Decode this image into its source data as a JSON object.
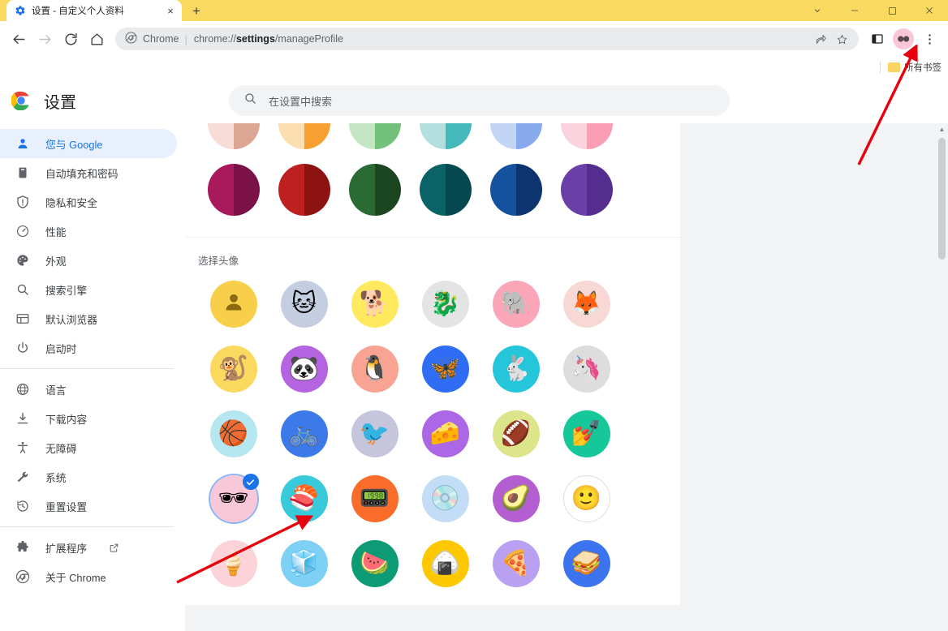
{
  "window": {
    "tab_title": "设置 - 自定义个人资料",
    "tab_close_label": "×",
    "new_tab_label": "+",
    "controls": {
      "collapse": "⌄",
      "minimize": "−",
      "maximize": "□",
      "close": "✕"
    }
  },
  "toolbar": {
    "back_icon": "back-arrow-icon",
    "forward_icon": "forward-arrow-icon",
    "reload_icon": "reload-icon",
    "home_icon": "home-icon",
    "omnibox": {
      "chip_label": "Chrome",
      "separator": "|",
      "url_prefix": "chrome://",
      "url_bold": "settings",
      "url_suffix": "/manageProfile",
      "share_icon": "share-icon",
      "bookmark_icon": "star-icon"
    },
    "side_panel_icon": "side-panel-icon",
    "profile_icon": "profile-avatar-sunglasses-icon",
    "menu_icon": "three-dot-menu-icon"
  },
  "bookmarks_bar": {
    "all_bookmarks_label": "所有书签",
    "folder_icon": "folder-icon"
  },
  "settings": {
    "logo": "chrome-logo-icon",
    "title": "设置",
    "search": {
      "icon": "search-icon",
      "placeholder": "在设置中搜索"
    }
  },
  "sidebar": {
    "items": [
      {
        "label": "您与 Google",
        "icon": "person-icon",
        "active": true
      },
      {
        "label": "自动填充和密码",
        "icon": "clipboard-icon",
        "active": false
      },
      {
        "label": "隐私和安全",
        "icon": "shield-icon",
        "active": false
      },
      {
        "label": "性能",
        "icon": "gauge-icon",
        "active": false
      },
      {
        "label": "外观",
        "icon": "palette-icon",
        "active": false
      },
      {
        "label": "搜索引擎",
        "icon": "search-icon",
        "active": false
      },
      {
        "label": "默认浏览器",
        "icon": "browser-window-icon",
        "active": false
      },
      {
        "label": "启动时",
        "icon": "power-icon",
        "active": false
      }
    ],
    "items2": [
      {
        "label": "语言",
        "icon": "globe-icon"
      },
      {
        "label": "下载内容",
        "icon": "download-icon"
      },
      {
        "label": "无障碍",
        "icon": "accessibility-icon"
      },
      {
        "label": "系统",
        "icon": "wrench-icon"
      },
      {
        "label": "重置设置",
        "icon": "history-restore-icon"
      }
    ],
    "items3": [
      {
        "label": "扩展程序",
        "icon": "puzzle-icon",
        "external": true
      },
      {
        "label": "关于 Chrome",
        "icon": "chrome-logo-icon",
        "external": false
      }
    ]
  },
  "profile_customization": {
    "color_rows": [
      [
        {
          "name": "peach",
          "light": "#f6ddd6",
          "dark": "#dba794"
        },
        {
          "name": "orange",
          "light": "#fcdfb0",
          "dark": "#f5a030"
        },
        {
          "name": "green",
          "light": "#c4e5c1",
          "dark": "#74c17c"
        },
        {
          "name": "teal",
          "light": "#b3e0df",
          "dark": "#45b8bb"
        },
        {
          "name": "blue",
          "light": "#c3d5f5",
          "dark": "#87a9ee"
        },
        {
          "name": "pink",
          "light": "#fbd3de",
          "dark": "#fa9db5"
        }
      ],
      [
        {
          "name": "magenta",
          "light": "#a81a5c",
          "dark": "#7b1247"
        },
        {
          "name": "red",
          "light": "#be1f1f",
          "dark": "#8c1212"
        },
        {
          "name": "dark-green",
          "light": "#2a6b34",
          "dark": "#1b4620"
        },
        {
          "name": "dark-teal",
          "light": "#0a6366",
          "dark": "#06484f"
        },
        {
          "name": "dark-blue",
          "light": "#14519e",
          "dark": "#0e3470"
        },
        {
          "name": "purple",
          "light": "#6b3fa8",
          "dark": "#552d8e"
        }
      ]
    ],
    "avatar_section_label": "选择头像",
    "avatar_rows": [
      [
        {
          "name": "default-person",
          "bg": "#f8cf4a",
          "glyph": "👤",
          "kind": "person",
          "selected": false
        },
        {
          "name": "origami-cat",
          "bg": "#c4cee0",
          "glyph": "🐱",
          "kind": "emoji",
          "selected": false
        },
        {
          "name": "origami-dog",
          "bg": "#ffe95e",
          "glyph": "🐕",
          "kind": "emoji",
          "selected": false
        },
        {
          "name": "origami-dragon",
          "bg": "#e3e4e3",
          "glyph": "🐉",
          "kind": "emoji",
          "selected": false
        },
        {
          "name": "origami-elephant",
          "bg": "#fba5b8",
          "glyph": "🐘",
          "kind": "emoji",
          "selected": false
        },
        {
          "name": "origami-fox",
          "bg": "#f7d8d4",
          "glyph": "🦊",
          "kind": "emoji",
          "selected": false
        }
      ],
      [
        {
          "name": "origami-monkey",
          "bg": "#fbd95f",
          "glyph": "🐒",
          "kind": "emoji",
          "selected": false
        },
        {
          "name": "origami-panda",
          "bg": "#b464e0",
          "glyph": "🐼",
          "kind": "emoji",
          "selected": false
        },
        {
          "name": "origami-penguin",
          "bg": "#f9a492",
          "glyph": "🐧",
          "kind": "emoji",
          "selected": false
        },
        {
          "name": "origami-butterfly",
          "bg": "#2f6ef4",
          "glyph": "🦋",
          "kind": "emoji",
          "selected": false
        },
        {
          "name": "origami-rabbit",
          "bg": "#26c6da",
          "glyph": "🐇",
          "kind": "emoji",
          "selected": false
        },
        {
          "name": "origami-unicorn",
          "bg": "#dddddd",
          "glyph": "🦄",
          "kind": "emoji",
          "selected": false
        }
      ],
      [
        {
          "name": "basketball",
          "bg": "#b4e7ef",
          "glyph": "🏀",
          "kind": "emoji",
          "selected": false
        },
        {
          "name": "bicycle",
          "bg": "#3b7ae8",
          "glyph": "🚲",
          "kind": "emoji",
          "selected": false
        },
        {
          "name": "bird",
          "bg": "#c5c5dc",
          "glyph": "🐦",
          "kind": "emoji",
          "selected": false
        },
        {
          "name": "cheese",
          "bg": "#ab67e6",
          "glyph": "🧀",
          "kind": "emoji",
          "selected": false
        },
        {
          "name": "football",
          "bg": "#dde58a",
          "glyph": "🏈",
          "kind": "emoji",
          "selected": false
        },
        {
          "name": "nail-polish",
          "bg": "#16c79a",
          "glyph": "💅",
          "kind": "emoji",
          "selected": false
        }
      ],
      [
        {
          "name": "sunglasses",
          "bg": "#f8c8d8",
          "glyph": "🕶",
          "kind": "emoji",
          "selected": true
        },
        {
          "name": "sushi",
          "bg": "#38cada",
          "glyph": "🍣",
          "kind": "emoji",
          "selected": false
        },
        {
          "name": "tamagotchi",
          "bg": "#f96c2a",
          "glyph": "📟",
          "kind": "emoji",
          "selected": false
        },
        {
          "name": "vinyl-record",
          "bg": "#c3ddf7",
          "glyph": "💿",
          "kind": "emoji",
          "selected": false
        },
        {
          "name": "avocado",
          "bg": "#b45fd1",
          "glyph": "🥑",
          "kind": "emoji",
          "selected": false
        },
        {
          "name": "smiley",
          "bg": "#ffffff",
          "glyph": "🙂",
          "kind": "emoji",
          "selected": false
        }
      ],
      [
        {
          "name": "ice-cream",
          "bg": "#fbd3d8",
          "glyph": "🍦",
          "kind": "emoji",
          "selected": false
        },
        {
          "name": "ice",
          "bg": "#7fd0f5",
          "glyph": "🧊",
          "kind": "emoji",
          "selected": false
        },
        {
          "name": "watermelon",
          "bg": "#0d9b76",
          "glyph": "🍉",
          "kind": "emoji",
          "selected": false
        },
        {
          "name": "onigiri",
          "bg": "#fdc800",
          "glyph": "🍙",
          "kind": "emoji",
          "selected": false
        },
        {
          "name": "pizza",
          "bg": "#b9a0f0",
          "glyph": "🍕",
          "kind": "emoji",
          "selected": false
        },
        {
          "name": "sandwich",
          "bg": "#3c74f0",
          "glyph": "🥪",
          "kind": "emoji",
          "selected": false
        }
      ]
    ]
  },
  "colors": {
    "titlebar": "#fad961",
    "accent": "#1a73e8",
    "active_nav_bg": "#e8f0fe",
    "annotation_arrow": "#e8000d"
  }
}
